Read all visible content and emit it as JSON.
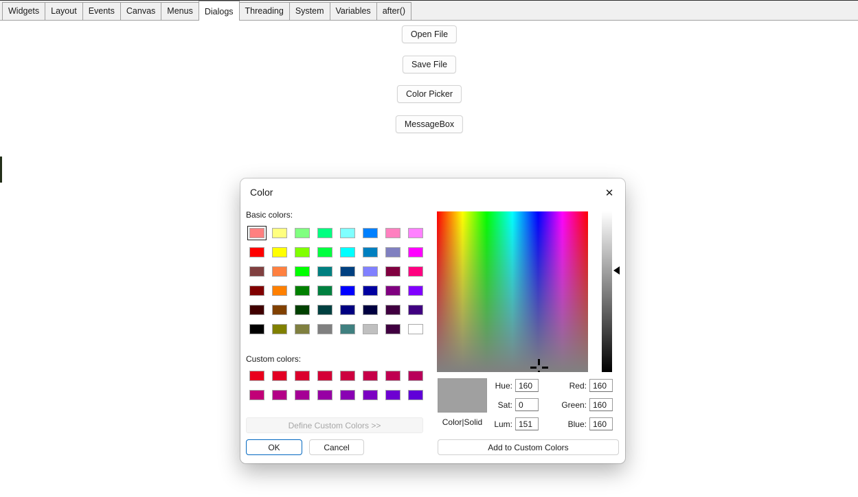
{
  "tabs": {
    "selected": "Dialogs",
    "items": [
      {
        "label": "Widgets"
      },
      {
        "label": "Layout"
      },
      {
        "label": "Events"
      },
      {
        "label": "Canvas"
      },
      {
        "label": "Menus"
      },
      {
        "label": "Dialogs"
      },
      {
        "label": "Threading"
      },
      {
        "label": "System"
      },
      {
        "label": "Variables"
      },
      {
        "label": "after()"
      }
    ]
  },
  "main": {
    "buttons": [
      "Open File",
      "Save File",
      "Color Picker",
      "MessageBox"
    ]
  },
  "dialog": {
    "title": "Color",
    "close_icon": "✕",
    "basic_colors_label": "Basic colors:",
    "basic_colors": [
      "#FF8080",
      "#FFFF80",
      "#80FF80",
      "#00FF80",
      "#80FFFF",
      "#0080FF",
      "#FF80C0",
      "#FF80FF",
      "#FF0000",
      "#FFFF00",
      "#80FF00",
      "#00FF40",
      "#00FFFF",
      "#0080C0",
      "#8080C0",
      "#FF00FF",
      "#804040",
      "#FF8040",
      "#00FF00",
      "#008080",
      "#004080",
      "#8080FF",
      "#800040",
      "#FF0080",
      "#800000",
      "#FF8000",
      "#008000",
      "#008040",
      "#0000FF",
      "#0000A0",
      "#800080",
      "#8000FF",
      "#400000",
      "#804000",
      "#004000",
      "#004040",
      "#000080",
      "#000040",
      "#400040",
      "#400080",
      "#000000",
      "#808000",
      "#808040",
      "#808080",
      "#408080",
      "#C0C0C0",
      "#400040",
      "#FFFFFF"
    ],
    "selected_basic_index": 0,
    "custom_colors_label": "Custom colors:",
    "custom_colors": [
      "#E9001C",
      "#E20024",
      "#DB002D",
      "#D40036",
      "#CD003F",
      "#C60048",
      "#BF0051",
      "#B8005A",
      "#C10077",
      "#B30086",
      "#A50095",
      "#9700A4",
      "#8900B3",
      "#7B00C2",
      "#6D00D1",
      "#6000D8"
    ],
    "define_custom_button": "Define Custom Colors >>",
    "ok_button": "OK",
    "cancel_button": "Cancel",
    "add_custom_button": "Add to Custom Colors",
    "preview_label": "Color|Solid",
    "preview_color": "#A0A0A0",
    "accent_color": "#0067C0",
    "fields": {
      "hue": {
        "label": "Hue:",
        "value": "160"
      },
      "sat": {
        "label": "Sat:",
        "value": "0"
      },
      "lum": {
        "label": "Lum:",
        "value": "151"
      },
      "red": {
        "label": "Red:",
        "value": "160"
      },
      "green": {
        "label": "Green:",
        "value": "160"
      },
      "blue": {
        "label": "Blue:",
        "value": "160"
      }
    }
  }
}
